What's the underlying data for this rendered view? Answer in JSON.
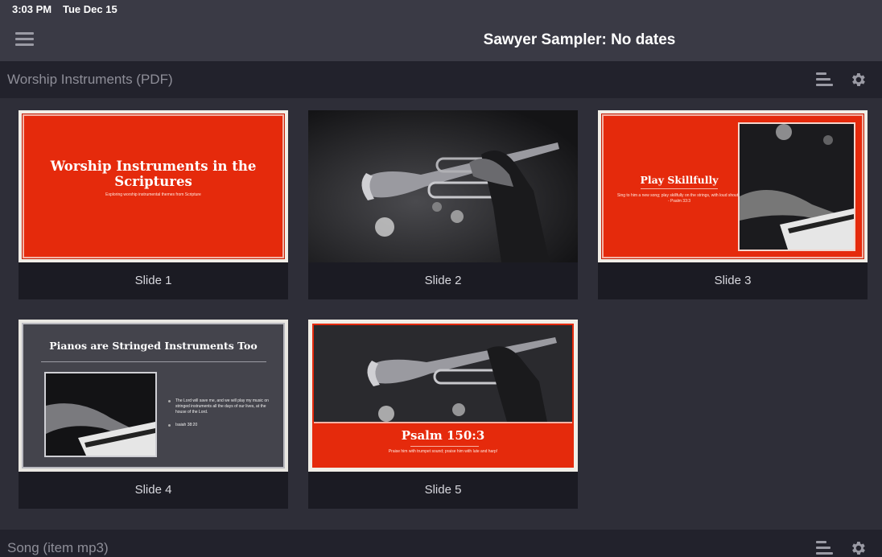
{
  "status_bar": {
    "time": "3:03 PM",
    "date": "Tue Dec 15"
  },
  "nav": {
    "title": "Sawyer Sampler: No dates",
    "menu_icon": "hamburger-menu-icon"
  },
  "sections": [
    {
      "title": "Worship Instruments (PDF)",
      "icons": [
        "sort-icon",
        "gear-icon"
      ]
    },
    {
      "title": "Song (item mp3)",
      "icons": [
        "sort-icon",
        "gear-icon"
      ]
    }
  ],
  "slides": [
    {
      "caption": "Slide 1",
      "title": "Worship Instruments in the Scriptures",
      "subtitle": "Exploring worship instrumental themes from Scripture"
    },
    {
      "caption": "Slide 2"
    },
    {
      "caption": "Slide 3",
      "title": "Play Skillfully",
      "body": "Sing to him a new song; play skillfully on the strings, with loud shouts. - Psalm 33:3"
    },
    {
      "caption": "Slide 4",
      "title": "Pianos are Stringed Instruments Too",
      "bullet1": "The Lord will save me, and we will play my music on stringed instruments all the days of our lives, at the house of the Lord.",
      "bullet2": "Isaiah 38:20"
    },
    {
      "caption": "Slide 5",
      "title": "Psalm 150:3",
      "subtitle": "Praise him with trumpet sound; praise him with lute and harp!"
    }
  ],
  "colors": {
    "accent_red": "#e52a0c",
    "nav_bg": "#3a3a45",
    "section_bg": "#22222c",
    "caption_bg": "#1b1b23"
  }
}
